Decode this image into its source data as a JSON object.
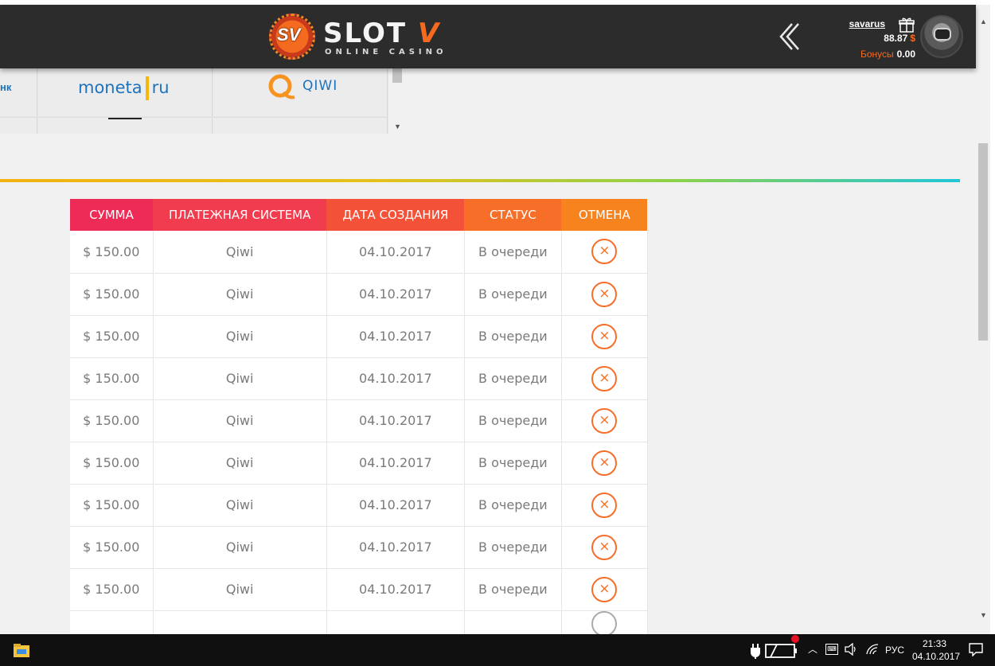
{
  "header": {
    "logo": {
      "mark": "SV",
      "word": "SLOT",
      "word_accent": "V",
      "tagline": "ONLINE CASINO"
    },
    "back_icon": "chevron-left-icon",
    "user": {
      "username": "savarus",
      "balance": "88.87",
      "currency": "$",
      "bonus_label": "Бонусы",
      "bonus_value": "0.00"
    }
  },
  "payment_methods": {
    "items": [
      {
        "label": "нк",
        "icon": "bank-logo-fragment"
      },
      {
        "label_left": "moneta",
        "label_right": "ru",
        "icon": "moneta-logo"
      },
      {
        "label": "QIWI",
        "icon": "qiwi-logo"
      }
    ]
  },
  "withdrawals": {
    "columns": [
      "СУММА",
      "ПЛАТЕЖНАЯ СИСТЕМА",
      "ДАТА СОЗДАНИЯ",
      "СТАТУС",
      "ОТМЕНА"
    ],
    "rows": [
      {
        "amount": "$ 150.00",
        "system": "Qiwi",
        "date": "04.10.2017",
        "status": "В очереди",
        "cancel": "×"
      },
      {
        "amount": "$ 150.00",
        "system": "Qiwi",
        "date": "04.10.2017",
        "status": "В очереди",
        "cancel": "×"
      },
      {
        "amount": "$ 150.00",
        "system": "Qiwi",
        "date": "04.10.2017",
        "status": "В очереди",
        "cancel": "×"
      },
      {
        "amount": "$ 150.00",
        "system": "Qiwi",
        "date": "04.10.2017",
        "status": "В очереди",
        "cancel": "×"
      },
      {
        "amount": "$ 150.00",
        "system": "Qiwi",
        "date": "04.10.2017",
        "status": "В очереди",
        "cancel": "×"
      },
      {
        "amount": "$ 150.00",
        "system": "Qiwi",
        "date": "04.10.2017",
        "status": "В очереди",
        "cancel": "×"
      },
      {
        "amount": "$ 150.00",
        "system": "Qiwi",
        "date": "04.10.2017",
        "status": "В очереди",
        "cancel": "×"
      },
      {
        "amount": "$ 150.00",
        "system": "Qiwi",
        "date": "04.10.2017",
        "status": "В очереди",
        "cancel": "×"
      },
      {
        "amount": "$ 150.00",
        "system": "Qiwi",
        "date": "04.10.2017",
        "status": "В очереди",
        "cancel": "×"
      }
    ]
  },
  "taskbar": {
    "explorer_icon": "file-explorer-icon",
    "tray": {
      "language": "РУС",
      "time": "21:33",
      "date": "04.10.2017"
    },
    "tray_icons": [
      "battery-charging-icon",
      "show-hidden-icons-chevron",
      "input-indicator-icon",
      "volume-icon",
      "wifi-icon",
      "notifications-icon"
    ]
  },
  "colors": {
    "header_bg": "#2c2c2c",
    "accent_orange": "#f46a1f",
    "table_header_start": "#ee2a56",
    "table_header_end": "#f7831f",
    "divider_start": "#f2b314",
    "divider_end": "#20c6d8"
  }
}
